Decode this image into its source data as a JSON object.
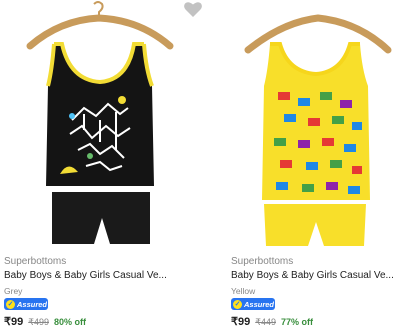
{
  "products": [
    {
      "brand": "Superbottoms",
      "title": "Baby Boys & Baby Girls Casual Ve...",
      "variant": "Grey",
      "assured_label": "Assured",
      "price": "₹99",
      "mrp": "₹499",
      "discount": "80% off",
      "colors": {
        "top": "#141414",
        "trim": "#f2dc35",
        "bottom": "#1a1a1a"
      }
    },
    {
      "brand": "Superbottoms",
      "title": "Baby Boys & Baby Girls Casual Ve...",
      "variant": "Yellow",
      "assured_label": "Assured",
      "price": "₹99",
      "mrp": "₹449",
      "discount": "77% off",
      "colors": {
        "top": "#f8df2a",
        "trim": "#f6d61c",
        "bottom": "#f8df2a"
      }
    }
  ],
  "colors": {
    "accent": "#2874f0",
    "discount": "#388e3c",
    "muted": "#878787"
  }
}
